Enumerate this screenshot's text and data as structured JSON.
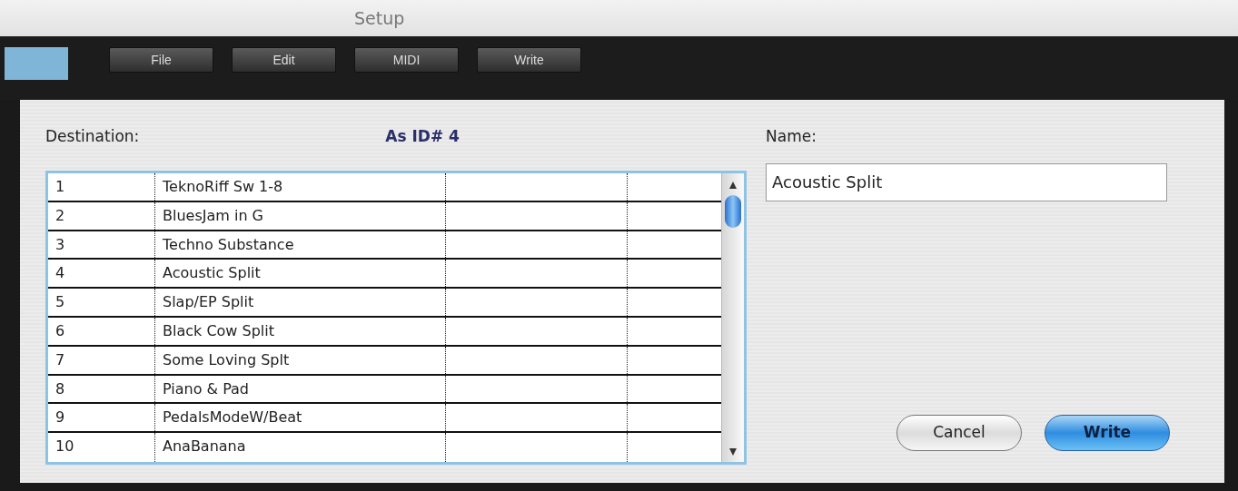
{
  "window": {
    "title": "Setup"
  },
  "toolbar": [
    "File",
    "Edit",
    "MIDI",
    "Write"
  ],
  "dialog": {
    "destination_label": "Destination:",
    "id_label": "As ID# 4",
    "table": {
      "rows": [
        {
          "number": "1",
          "name": "TeknoRiff Sw 1-8"
        },
        {
          "number": "2",
          "name": "BluesJam in G"
        },
        {
          "number": "3",
          "name": "Techno Substance"
        },
        {
          "number": "4",
          "name": "Acoustic Split"
        },
        {
          "number": "5",
          "name": "Slap/EP Split"
        },
        {
          "number": "6",
          "name": "Black Cow Split"
        },
        {
          "number": "7",
          "name": "Some Loving Splt"
        },
        {
          "number": "8",
          "name": "Piano & Pad"
        },
        {
          "number": "9",
          "name": "PedalsModeW/Beat"
        },
        {
          "number": "10",
          "name": "AnaBanana"
        }
      ]
    },
    "name_label": "Name:",
    "name_value": "Acoustic Split",
    "buttons": [
      {
        "label": "Cancel",
        "kind": "secondary"
      },
      {
        "label": "Write",
        "kind": "default"
      }
    ]
  }
}
